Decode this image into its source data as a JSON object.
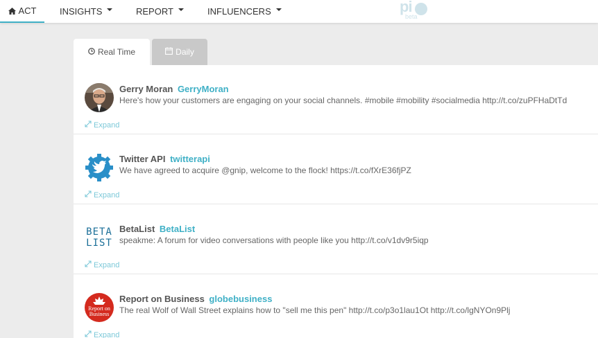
{
  "navbar": {
    "items": [
      {
        "label": "ACT",
        "icon": "home-icon"
      },
      {
        "label": "INSIGHTS"
      },
      {
        "label": "REPORT"
      },
      {
        "label": "INFLUENCERS"
      }
    ],
    "logo": {
      "text": "pi",
      "beta": "beta"
    }
  },
  "tabs": [
    {
      "label": "Real Time",
      "icon": "clock-icon",
      "active": true
    },
    {
      "label": "Daily",
      "icon": "calendar-icon",
      "active": false
    }
  ],
  "feed": {
    "expand_label": "Expand",
    "tweets": [
      {
        "author": "Gerry Moran",
        "handle": "GerryMoran",
        "text": "Here's how your customers are engaging on your social channels. #mobile #mobility #socialmedia http://t.co/zuPFHaDtTd"
      },
      {
        "author": "Twitter API",
        "handle": "twitterapi",
        "text": "We have agreed to acquire @gnip, welcome to the flock! https://t.co/fXrE36fjPZ"
      },
      {
        "author": "BetaList",
        "handle": "BetaList",
        "text": "speakme: A forum for video conversations with people like you http://t.co/v1dv9r5iqp",
        "avatar_text": [
          "BETA",
          "LIST"
        ]
      },
      {
        "author": "Report on Business",
        "handle": "globebusiness",
        "text": "The real Wolf of Wall Street explains how to \"sell me this pen\" http://t.co/p3o1lau1Ot http://t.co/lgNYOn9Plj",
        "avatar_text": [
          "Report on",
          "Business"
        ]
      }
    ]
  },
  "colors": {
    "accent": "#3fb0c6",
    "background": "#ececec"
  }
}
